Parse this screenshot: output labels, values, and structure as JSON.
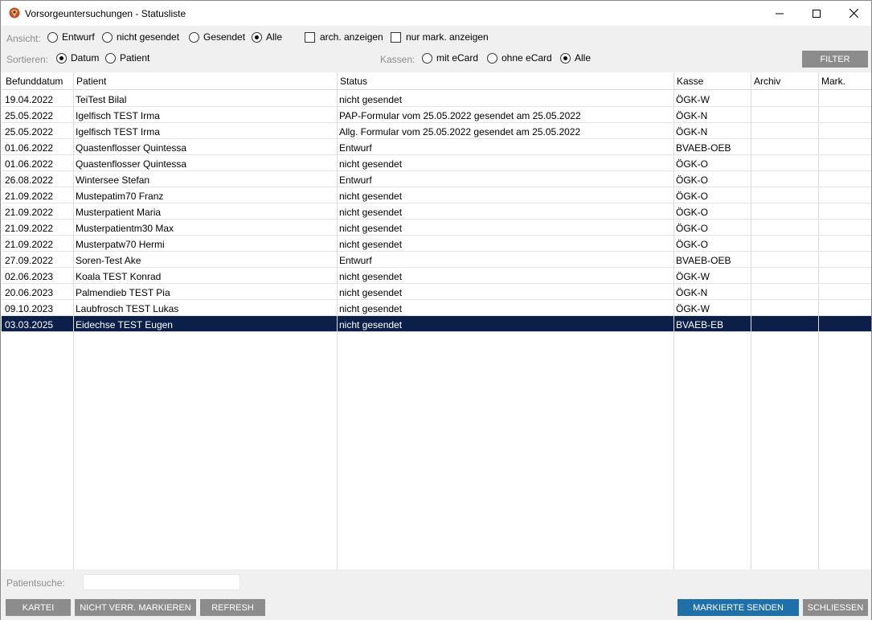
{
  "window": {
    "title": "Vorsorgeuntersuchungen - Statusliste"
  },
  "toolbar": {
    "ansicht_label": "Ansicht:",
    "ansicht_options": [
      "Entwurf",
      "nicht gesendet",
      "Gesendet",
      "Alle"
    ],
    "ansicht_selected": "Alle",
    "arch_label": "arch. anzeigen",
    "nurmark_label": "nur mark. anzeigen",
    "sortieren_label": "Sortieren:",
    "sort_options": [
      "Datum",
      "Patient"
    ],
    "sort_selected": "Datum",
    "kassen_label": "Kassen:",
    "kassen_options": [
      "mit eCard",
      "ohne eCard",
      "Alle"
    ],
    "kassen_selected": "Alle",
    "filter_label": "FILTER"
  },
  "table": {
    "columns": [
      "Befunddatum",
      "Patient",
      "Status",
      "Kasse",
      "Archiv",
      "Mark."
    ],
    "rows": [
      {
        "date": "19.04.2022",
        "patient": "TeiTest Bilal",
        "status": "nicht gesendet",
        "kasse": "ÖGK-W"
      },
      {
        "date": "25.05.2022",
        "patient": "Igelfisch TEST Irma",
        "status": "PAP-Formular vom 25.05.2022 gesendet am 25.05.2022",
        "kasse": "ÖGK-N"
      },
      {
        "date": "25.05.2022",
        "patient": "Igelfisch TEST Irma",
        "status": "Allg. Formular vom 25.05.2022 gesendet am 25.05.2022",
        "kasse": "ÖGK-N"
      },
      {
        "date": "01.06.2022",
        "patient": "Quastenflosser Quintessa",
        "status": "Entwurf",
        "kasse": "BVAEB-OEB"
      },
      {
        "date": "01.06.2022",
        "patient": "Quastenflosser Quintessa",
        "status": "nicht gesendet",
        "kasse": "ÖGK-O"
      },
      {
        "date": "26.08.2022",
        "patient": "Wintersee Stefan",
        "status": "Entwurf",
        "kasse": "ÖGK-O"
      },
      {
        "date": "21.09.2022",
        "patient": "Mustepatim70 Franz",
        "status": "nicht gesendet",
        "kasse": "ÖGK-O"
      },
      {
        "date": "21.09.2022",
        "patient": "Musterpatient Maria",
        "status": "nicht gesendet",
        "kasse": "ÖGK-O"
      },
      {
        "date": "21.09.2022",
        "patient": "Musterpatientm30 Max",
        "status": "nicht gesendet",
        "kasse": "ÖGK-O"
      },
      {
        "date": "21.09.2022",
        "patient": "Musterpatw70 Hermi",
        "status": "nicht gesendet",
        "kasse": "ÖGK-O"
      },
      {
        "date": "27.09.2022",
        "patient": "Soren-Test Ake",
        "status": "Entwurf",
        "kasse": "BVAEB-OEB"
      },
      {
        "date": "02.06.2023",
        "patient": "Koala TEST Konrad",
        "status": "nicht gesendet",
        "kasse": "ÖGK-W"
      },
      {
        "date": "20.06.2023",
        "patient": "Palmendieb TEST Pia",
        "status": "nicht gesendet",
        "kasse": "ÖGK-N"
      },
      {
        "date": "09.10.2023",
        "patient": "Laubfrosch TEST Lukas",
        "status": "nicht gesendet",
        "kasse": "ÖGK-W"
      },
      {
        "date": "03.03.2025",
        "patient": "Eidechse TEST Eugen",
        "status": "nicht gesendet",
        "kasse": "BVAEB-EB",
        "selected": true
      }
    ]
  },
  "search": {
    "label": "Patientsuche:",
    "value": ""
  },
  "buttons": {
    "kartei": "KARTEI",
    "nicht_verr": "NICHT VERR. MARKIEREN",
    "refresh": "REFRESH",
    "markierte_senden": "MARKIERTE SENDEN",
    "schliessen": "SCHLIESSEN"
  },
  "colors": {
    "selection": "#0b1f49",
    "primary_button": "#1f6fa8",
    "secondary_button": "#8c8c8c"
  }
}
